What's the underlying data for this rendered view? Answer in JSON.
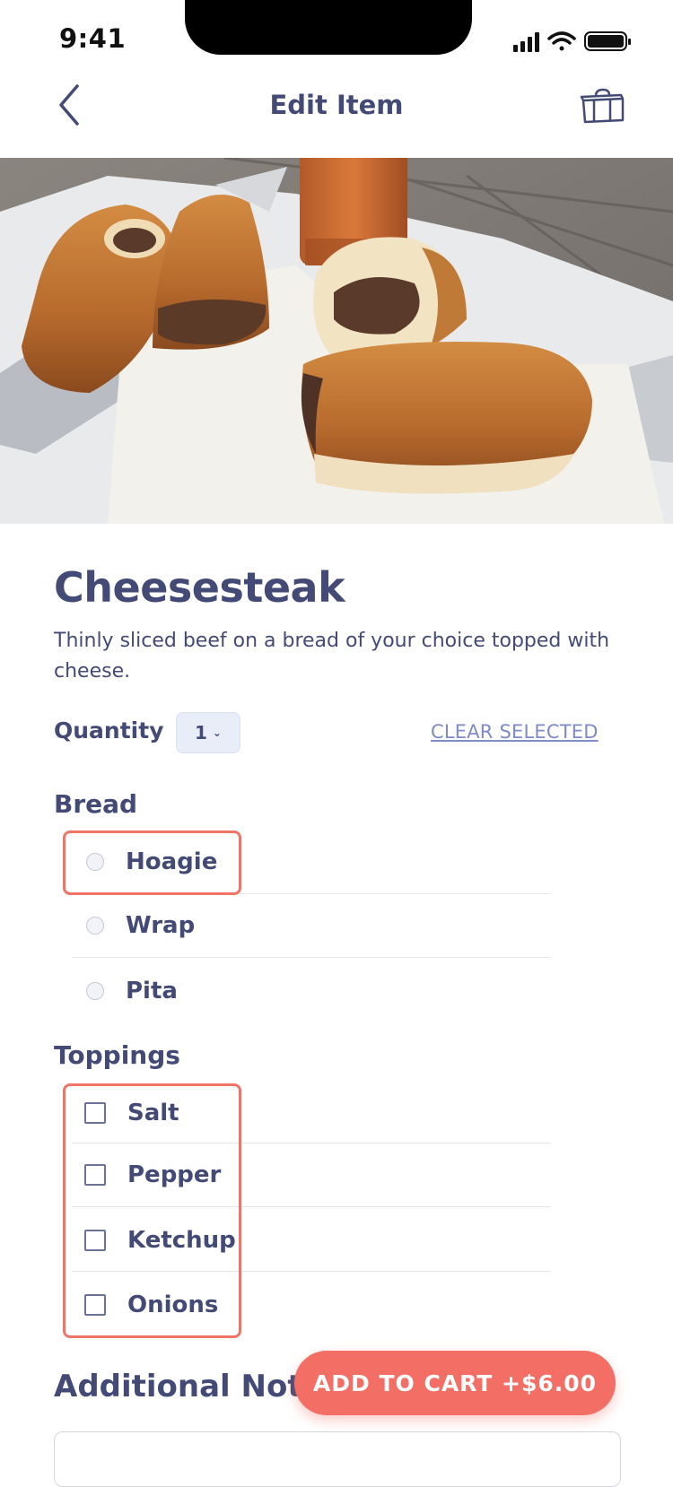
{
  "status_bar": {
    "time": "9:41"
  },
  "nav": {
    "title": "Edit Item"
  },
  "item": {
    "name": "Cheesesteak",
    "description": "Thinly sliced beef on a bread of your choice topped with cheese."
  },
  "quantity": {
    "label": "Quantity",
    "value": "1",
    "clear_label": "CLEAR SELECTED"
  },
  "bread": {
    "title": "Bread",
    "options": [
      {
        "label": "Hoagie"
      },
      {
        "label": "Wrap"
      },
      {
        "label": "Pita"
      }
    ]
  },
  "toppings": {
    "title": "Toppings",
    "options": [
      {
        "label": "Salt"
      },
      {
        "label": "Pepper"
      },
      {
        "label": "Ketchup"
      },
      {
        "label": "Onions"
      }
    ]
  },
  "notes": {
    "title": "Additional Notes"
  },
  "cart_button": {
    "label": "ADD TO CART +$6.00"
  },
  "colors": {
    "primary_text": "#434a75",
    "accent": "#f36f66",
    "link": "#7e8bc6",
    "highlight": "#f07468"
  }
}
